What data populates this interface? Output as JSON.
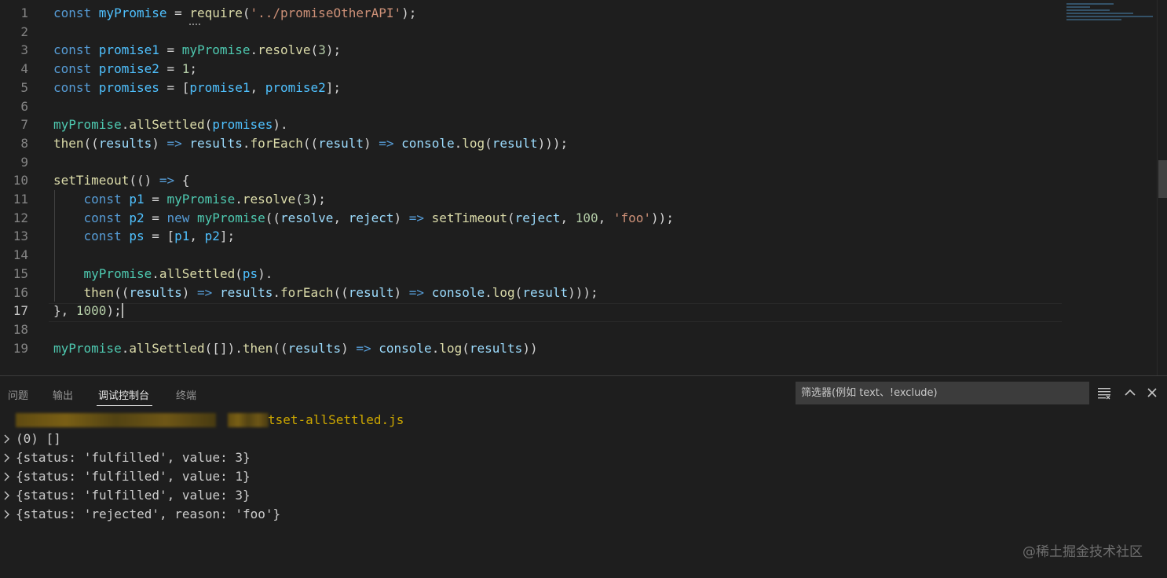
{
  "editor": {
    "lines": [
      {
        "n": "1",
        "tokens": [
          [
            "kw",
            "const "
          ],
          [
            "var",
            "myPromise"
          ],
          [
            "op",
            " = "
          ],
          [
            "fn",
            "require"
          ],
          [
            "op",
            "("
          ],
          [
            "str",
            "'../promiseOtherAPI'"
          ],
          [
            "op",
            ");"
          ]
        ]
      },
      {
        "n": "2",
        "tokens": []
      },
      {
        "n": "3",
        "tokens": [
          [
            "kw",
            "const "
          ],
          [
            "var",
            "promise1"
          ],
          [
            "op",
            " = "
          ],
          [
            "cls",
            "myPromise"
          ],
          [
            "op",
            "."
          ],
          [
            "fn",
            "resolve"
          ],
          [
            "op",
            "("
          ],
          [
            "num",
            "3"
          ],
          [
            "op",
            ");"
          ]
        ]
      },
      {
        "n": "4",
        "tokens": [
          [
            "kw",
            "const "
          ],
          [
            "var",
            "promise2"
          ],
          [
            "op",
            " = "
          ],
          [
            "num",
            "1"
          ],
          [
            "op",
            ";"
          ]
        ]
      },
      {
        "n": "5",
        "tokens": [
          [
            "kw",
            "const "
          ],
          [
            "var",
            "promises"
          ],
          [
            "op",
            " = ["
          ],
          [
            "var",
            "promise1"
          ],
          [
            "op",
            ", "
          ],
          [
            "var",
            "promise2"
          ],
          [
            "op",
            "];"
          ]
        ]
      },
      {
        "n": "6",
        "tokens": []
      },
      {
        "n": "7",
        "tokens": [
          [
            "cls",
            "myPromise"
          ],
          [
            "op",
            "."
          ],
          [
            "fn",
            "allSettled"
          ],
          [
            "op",
            "("
          ],
          [
            "var",
            "promises"
          ],
          [
            "op",
            ")."
          ]
        ]
      },
      {
        "n": "8",
        "tokens": [
          [
            "fn",
            "then"
          ],
          [
            "op",
            "(("
          ],
          [
            "prm",
            "results"
          ],
          [
            "op",
            ") "
          ],
          [
            "kw",
            "=>"
          ],
          [
            "op",
            " "
          ],
          [
            "prm",
            "results"
          ],
          [
            "op",
            "."
          ],
          [
            "fn",
            "forEach"
          ],
          [
            "op",
            "(("
          ],
          [
            "prm",
            "result"
          ],
          [
            "op",
            ") "
          ],
          [
            "kw",
            "=>"
          ],
          [
            "op",
            " "
          ],
          [
            "prm",
            "console"
          ],
          [
            "op",
            "."
          ],
          [
            "fn",
            "log"
          ],
          [
            "op",
            "("
          ],
          [
            "prm",
            "result"
          ],
          [
            "op",
            ")));"
          ]
        ]
      },
      {
        "n": "9",
        "tokens": []
      },
      {
        "n": "10",
        "tokens": [
          [
            "fn",
            "setTimeout"
          ],
          [
            "op",
            "(() "
          ],
          [
            "kw",
            "=>"
          ],
          [
            "op",
            " {"
          ]
        ]
      },
      {
        "n": "11",
        "tokens": [
          [
            "op",
            "    "
          ],
          [
            "kw",
            "const "
          ],
          [
            "var",
            "p1"
          ],
          [
            "op",
            " = "
          ],
          [
            "cls",
            "myPromise"
          ],
          [
            "op",
            "."
          ],
          [
            "fn",
            "resolve"
          ],
          [
            "op",
            "("
          ],
          [
            "num",
            "3"
          ],
          [
            "op",
            ");"
          ]
        ]
      },
      {
        "n": "12",
        "tokens": [
          [
            "op",
            "    "
          ],
          [
            "kw",
            "const "
          ],
          [
            "var",
            "p2"
          ],
          [
            "op",
            " = "
          ],
          [
            "kw",
            "new "
          ],
          [
            "cls",
            "myPromise"
          ],
          [
            "op",
            "(("
          ],
          [
            "prm",
            "resolve"
          ],
          [
            "op",
            ", "
          ],
          [
            "prm",
            "reject"
          ],
          [
            "op",
            ") "
          ],
          [
            "kw",
            "=>"
          ],
          [
            "op",
            " "
          ],
          [
            "fn",
            "setTimeout"
          ],
          [
            "op",
            "("
          ],
          [
            "prm",
            "reject"
          ],
          [
            "op",
            ", "
          ],
          [
            "num",
            "100"
          ],
          [
            "op",
            ", "
          ],
          [
            "str",
            "'foo'"
          ],
          [
            "op",
            "));"
          ]
        ]
      },
      {
        "n": "13",
        "tokens": [
          [
            "op",
            "    "
          ],
          [
            "kw",
            "const "
          ],
          [
            "var",
            "ps"
          ],
          [
            "op",
            " = ["
          ],
          [
            "var",
            "p1"
          ],
          [
            "op",
            ", "
          ],
          [
            "var",
            "p2"
          ],
          [
            "op",
            "];"
          ]
        ]
      },
      {
        "n": "14",
        "tokens": []
      },
      {
        "n": "15",
        "tokens": [
          [
            "op",
            "    "
          ],
          [
            "cls",
            "myPromise"
          ],
          [
            "op",
            "."
          ],
          [
            "fn",
            "allSettled"
          ],
          [
            "op",
            "("
          ],
          [
            "var",
            "ps"
          ],
          [
            "op",
            ")."
          ]
        ]
      },
      {
        "n": "16",
        "tokens": [
          [
            "op",
            "    "
          ],
          [
            "fn",
            "then"
          ],
          [
            "op",
            "(("
          ],
          [
            "prm",
            "results"
          ],
          [
            "op",
            ") "
          ],
          [
            "kw",
            "=>"
          ],
          [
            "op",
            " "
          ],
          [
            "prm",
            "results"
          ],
          [
            "op",
            "."
          ],
          [
            "fn",
            "forEach"
          ],
          [
            "op",
            "(("
          ],
          [
            "prm",
            "result"
          ],
          [
            "op",
            ") "
          ],
          [
            "kw",
            "=>"
          ],
          [
            "op",
            " "
          ],
          [
            "prm",
            "console"
          ],
          [
            "op",
            "."
          ],
          [
            "fn",
            "log"
          ],
          [
            "op",
            "("
          ],
          [
            "prm",
            "result"
          ],
          [
            "op",
            ")));"
          ]
        ]
      },
      {
        "n": "17",
        "tokens": [
          [
            "op",
            "}, "
          ],
          [
            "num",
            "1000"
          ],
          [
            "op",
            ");"
          ]
        ],
        "active": true
      },
      {
        "n": "18",
        "tokens": []
      },
      {
        "n": "19",
        "tokens": [
          [
            "cls",
            "myPromise"
          ],
          [
            "op",
            "."
          ],
          [
            "fn",
            "allSettled"
          ],
          [
            "op",
            "([])."
          ],
          [
            "fn",
            "then"
          ],
          [
            "op",
            "(("
          ],
          [
            "prm",
            "results"
          ],
          [
            "op",
            ") "
          ],
          [
            "kw",
            "=>"
          ],
          [
            "op",
            " "
          ],
          [
            "prm",
            "console"
          ],
          [
            "op",
            "."
          ],
          [
            "fn",
            "log"
          ],
          [
            "op",
            "("
          ],
          [
            "prm",
            "results"
          ],
          [
            "op",
            "))"
          ]
        ]
      }
    ]
  },
  "panel": {
    "tabs": [
      "问题",
      "输出",
      "调试控制台",
      "终端"
    ],
    "active_tab": "调试控制台",
    "filter_placeholder": "筛选器(例如 text、!exclude)",
    "file_label": "tset-allSettled.js",
    "output": [
      "(0) []",
      "{status: 'fulfilled', value: 3}",
      "{status: 'fulfilled', value: 1}",
      "{status: 'fulfilled', value: 3}",
      "{status: 'rejected', reason: 'foo'}"
    ],
    "icons": [
      "collapse-all-icon",
      "chevron-up-icon",
      "close-icon"
    ]
  },
  "watermark": "@稀土掘金技术社区"
}
